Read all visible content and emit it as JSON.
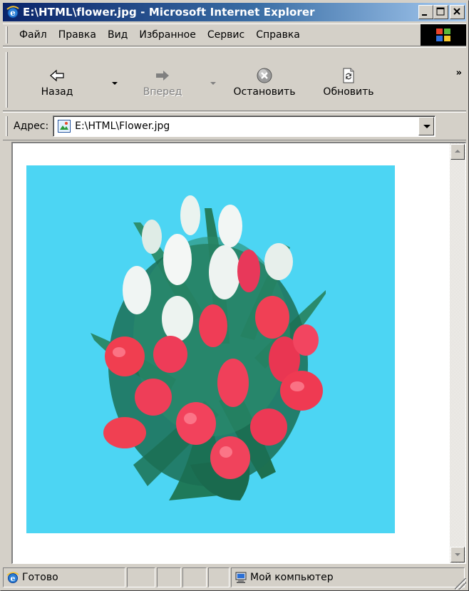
{
  "window": {
    "title": "E:\\HTML\\flower.jpg - Microsoft Internet Explorer",
    "minimize_label": "_",
    "maximize_label": "□",
    "close_label": "×"
  },
  "menu": {
    "items": [
      {
        "label": "Файл"
      },
      {
        "label": "Правка"
      },
      {
        "label": "Вид"
      },
      {
        "label": "Избранное"
      },
      {
        "label": "Сервис"
      },
      {
        "label": "Справка"
      }
    ]
  },
  "toolbar": {
    "back_label": "Назад",
    "forward_label": "Вперед",
    "stop_label": "Остановить",
    "refresh_label": "Обновить",
    "more_label": "»"
  },
  "address": {
    "label": "Адрес:",
    "value": "E:\\HTML\\Flower.jpg"
  },
  "status": {
    "text": "Готово",
    "zone": "Мой компьютер"
  },
  "colors": {
    "image_background": "#4cd5f3",
    "title_gradient_start": "#0a246a",
    "title_gradient_end": "#a6caf0"
  },
  "icons": {
    "ie": "ie-logo-icon",
    "back": "back-arrow-icon",
    "forward": "forward-arrow-icon",
    "stop": "stop-icon",
    "refresh": "refresh-icon",
    "page": "image-file-icon",
    "status": "ie-logo-icon",
    "zone": "my-computer-icon"
  }
}
